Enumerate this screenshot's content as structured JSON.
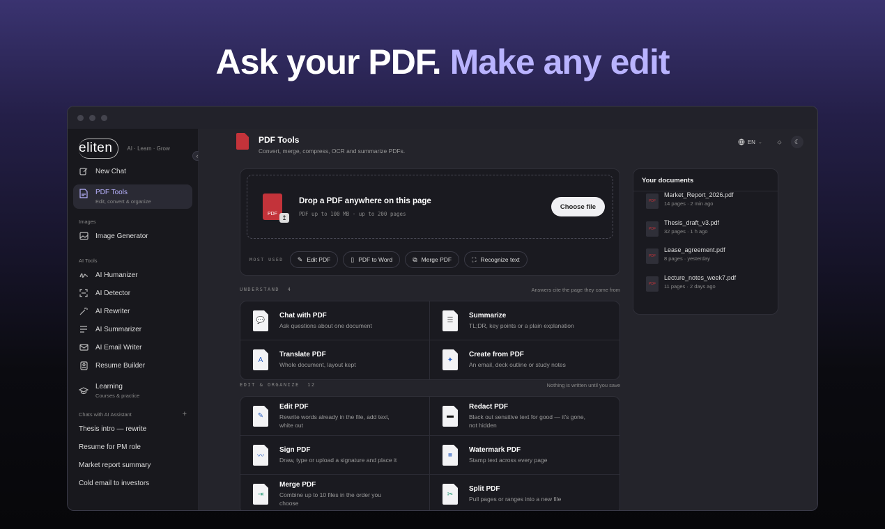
{
  "headline": {
    "part1": "Ask your PDF.",
    "part2": "Make any edit"
  },
  "sidebar": {
    "logo": "eliten",
    "tagline": "AI · Learn · Grow",
    "new_chat": "New Chat",
    "active": {
      "title": "PDF Tools",
      "subtitle": "Edit, convert & organize"
    },
    "images_label": "Images",
    "image_generator": "Image Generator",
    "ai_tools_label": "AI Tools",
    "ai_tools": [
      {
        "label": "AI Humanizer",
        "icon": "signature-icon"
      },
      {
        "label": "AI Detector",
        "icon": "scan-icon"
      },
      {
        "label": "AI Rewriter",
        "icon": "wand-icon"
      },
      {
        "label": "AI Summarizer",
        "icon": "lines-icon"
      },
      {
        "label": "AI Email Writer",
        "icon": "mail-icon"
      },
      {
        "label": "Resume Builder",
        "icon": "id-card-icon"
      }
    ],
    "learning": {
      "title": "Learning",
      "subtitle": "Courses & practice"
    },
    "chats_label": "Chats with AI Assistant",
    "chats": [
      "Thesis intro — rewrite",
      "Resume for PM role",
      "Market report summary",
      "Cold email to investors"
    ]
  },
  "header": {
    "title": "PDF Tools",
    "subtitle": "Convert, merge, compress, OCR and summarize PDFs.",
    "lang": "EN"
  },
  "upload": {
    "title": "Drop a PDF anywhere on this page",
    "subtitle": "PDF up to 100 MB · up to 200 pages",
    "button": "Choose file",
    "pdf_badge": "PDF",
    "most_used_label": "MOST USED",
    "chips": [
      "Edit PDF",
      "PDF to Word",
      "Merge PDF",
      "Recognize text"
    ]
  },
  "understand": {
    "label": "UNDERSTAND",
    "count": "4",
    "note": "Answers cite the page they came from",
    "tools": [
      {
        "title": "Chat with PDF",
        "desc": "Ask questions about one document",
        "icon": "chat-doc-icon"
      },
      {
        "title": "Summarize",
        "desc": "TL;DR, key points or a plain explanation",
        "icon": "summary-doc-icon"
      },
      {
        "title": "Translate PDF",
        "desc": "Whole document, layout kept",
        "icon": "translate-doc-icon"
      },
      {
        "title": "Create from PDF",
        "desc": "An email, deck outline or study notes",
        "icon": "sparkle-doc-icon"
      }
    ]
  },
  "edit": {
    "label": "EDIT & ORGANIZE",
    "count": "12",
    "note": "Nothing is written until you save",
    "tools": [
      {
        "title": "Edit PDF",
        "desc": "Rewrite words already in the file, add text, white out",
        "icon": "pencil-doc-icon"
      },
      {
        "title": "Redact PDF",
        "desc": "Black out sensitive text for good — it's gone, not hidden",
        "icon": "redact-doc-icon"
      },
      {
        "title": "Sign PDF",
        "desc": "Draw, type or upload a signature and place it",
        "icon": "sign-doc-icon"
      },
      {
        "title": "Watermark PDF",
        "desc": "Stamp text across every page",
        "icon": "watermark-doc-icon"
      },
      {
        "title": "Merge PDF",
        "desc": "Combine up to 10 files in the order you choose",
        "icon": "merge-doc-icon"
      },
      {
        "title": "Split PDF",
        "desc": "Pull pages or ranges into a new file",
        "icon": "split-doc-icon"
      }
    ]
  },
  "documents": {
    "title": "Your documents",
    "items": [
      {
        "name": "Market_Report_2026.pdf",
        "meta": "14 pages · 2 min ago"
      },
      {
        "name": "Thesis_draft_v3.pdf",
        "meta": "32 pages · 1 h ago"
      },
      {
        "name": "Lease_agreement.pdf",
        "meta": "8 pages · yesterday"
      },
      {
        "name": "Lecture_notes_week7.pdf",
        "meta": "11 pages · 2 days ago"
      }
    ]
  }
}
